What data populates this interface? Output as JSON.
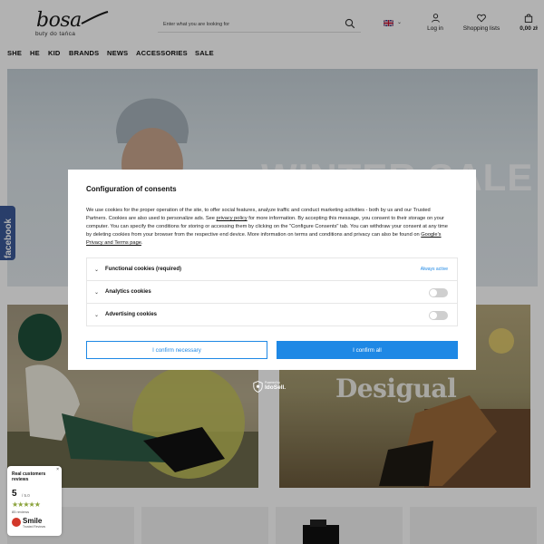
{
  "brand": {
    "name": "bosa",
    "tagline": "buty do tańca"
  },
  "search": {
    "placeholder": "Enter what you are looking for"
  },
  "header_actions": {
    "login": "Log in",
    "lists": "Shopping lists",
    "cart": "0,00 zł"
  },
  "nav": [
    "SHE",
    "HE",
    "KID",
    "BRANDS",
    "NEWS",
    "ACCESSORIES",
    "SALE"
  ],
  "hero": {
    "title": "WINTER SALE"
  },
  "social_tab": {
    "label": "facebook"
  },
  "promo_cards": {
    "right_brand": "Desigual"
  },
  "consent": {
    "title": "Configuration of consents",
    "body_part1": "We use cookies for the proper operation of the site, to offer social features, analyze traffic and conduct marketing activities - both by us and our Trusted Partners. Cookies are also used to personalize ads. See ",
    "privacy_link": "privacy policy",
    "body_part2": " for more information. By accepting this message, you consent to their storage on your computer. You can specify the conditions for storing or accessing them by clicking on the \"Configure Consents\" tab. You can withdraw your consent at any time by deleting cookies from your browser from the respective end device. More information on terms and conditions and privacy can also be found on ",
    "google_link": "Google's Privacy and Terms page",
    "body_end": ".",
    "rows": [
      {
        "label": "Functional cookies (required)",
        "status": "Always active"
      },
      {
        "label": "Analytics cookies"
      },
      {
        "label": "Advertising cookies"
      }
    ],
    "btn_necessary": "I confirm necessary",
    "btn_all": "I confirm all"
  },
  "idosell": {
    "powered": "Powered by",
    "name": "IdoSell."
  },
  "reviews_widget": {
    "heading": "Real customers reviews",
    "score": "5",
    "max": "/ 5.0",
    "stars": "★★★★★",
    "count": "85 reviews",
    "brand": "Smile",
    "brand_sub": "Trusted Reviews",
    "close": "×"
  },
  "colors": {
    "accent": "#1e88e5",
    "facebook": "#3b5998",
    "stars": "#8ba33c"
  }
}
